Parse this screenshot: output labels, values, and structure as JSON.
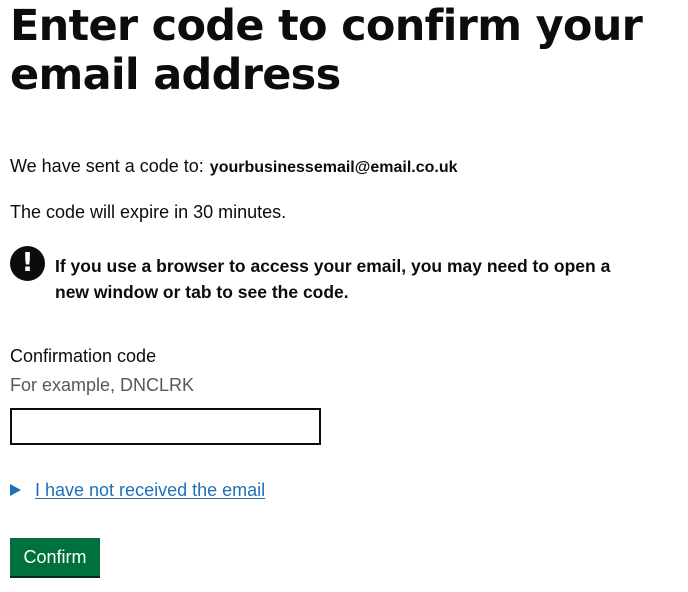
{
  "heading": "Enter code to confirm your email address",
  "sent": {
    "prefix": "We have sent a code to:",
    "email": "yourbusinessemail@email.co.uk"
  },
  "expiry": "The code will expire in 30 minutes.",
  "warning": {
    "icon": "!",
    "text": "If you use a browser to access your email, you may need to open a new window or tab to see the code."
  },
  "field": {
    "label": "Confirmation code",
    "hint": "For example, DNCLRK",
    "value": ""
  },
  "details": {
    "summary": "I have not received the email"
  },
  "button": {
    "label": "Confirm"
  },
  "colors": {
    "text": "#0b0c0c",
    "link": "#1d70b8",
    "hint": "#505a5f",
    "button": "#00703c"
  }
}
